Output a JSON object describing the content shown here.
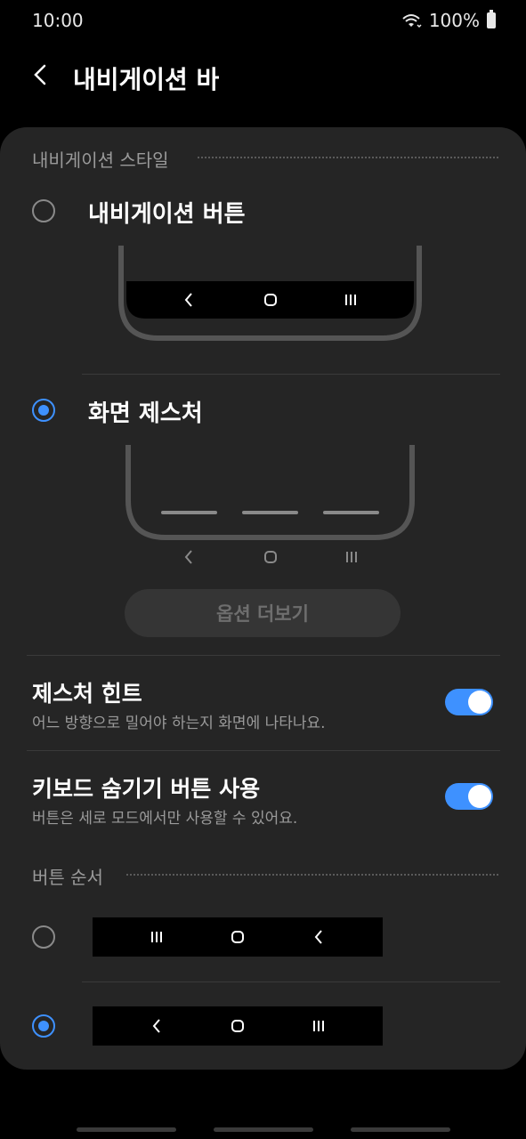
{
  "status_bar": {
    "time": "10:00",
    "battery": "100%"
  },
  "header": {
    "title": "내비게이션 바"
  },
  "sections": {
    "nav_style": "내비게이션 스타일",
    "button_order": "버튼 순서"
  },
  "nav_style_options": [
    {
      "label": "내비게이션 버튼",
      "selected": false
    },
    {
      "label": "화면 제스처",
      "selected": true
    }
  ],
  "more_options_label": "옵션 더보기",
  "settings": [
    {
      "title": "제스처 힌트",
      "subtitle": "어느 방향으로 밀어야 하는지 화면에 나타나요.",
      "enabled": true
    },
    {
      "title": "키보드 숨기기 버튼 사용",
      "subtitle": "버튼은 세로 모드에서만 사용할 수 있어요.",
      "enabled": true
    }
  ],
  "button_order_options": [
    {
      "selected": false,
      "order": [
        "recents-icon",
        "home-icon",
        "back-icon"
      ]
    },
    {
      "selected": true,
      "order": [
        "back-icon",
        "home-icon",
        "recents-icon"
      ]
    }
  ],
  "colors": {
    "accent": "#3e91ff",
    "card": "#252525",
    "background": "#000000"
  }
}
